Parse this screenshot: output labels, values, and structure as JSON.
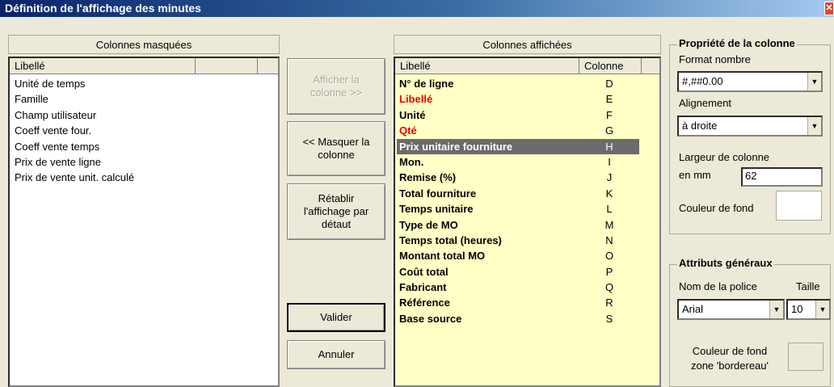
{
  "window": {
    "title": "Définition de l'affichage des minutes",
    "close_glyph": "✕"
  },
  "hidden_columns": {
    "header": "Colonnes masquées",
    "column_header": "Libellé",
    "items": [
      "Unité de temps",
      "Famille",
      "Champ utilisateur",
      "Coeff vente four.",
      "Coeff vente temps",
      "Prix de vente ligne",
      "Prix de vente unit. calculé"
    ]
  },
  "buttons": {
    "show_column": "Afficher la colonne >>",
    "hide_column": "<< Masquer la colonne",
    "restore_default": "Rétablir l'affichage par détaut",
    "validate": "Valider",
    "cancel": "Annuler"
  },
  "shown_columns": {
    "header": "Colonnes affichées",
    "col_label": "Libellé",
    "col_code": "Colonne",
    "rows": [
      {
        "label": "N° de ligne",
        "code": "D",
        "red": false,
        "selected": false
      },
      {
        "label": "Libellé",
        "code": "E",
        "red": true,
        "selected": false
      },
      {
        "label": "Unité",
        "code": "F",
        "red": false,
        "selected": false
      },
      {
        "label": "Qté",
        "code": "G",
        "red": true,
        "selected": false
      },
      {
        "label": "Prix unitaire fourniture",
        "code": "H",
        "red": false,
        "selected": true
      },
      {
        "label": "Mon.",
        "code": "I",
        "red": false,
        "selected": false
      },
      {
        "label": "Remise (%)",
        "code": "J",
        "red": false,
        "selected": false
      },
      {
        "label": "Total fourniture",
        "code": "K",
        "red": false,
        "selected": false
      },
      {
        "label": "Temps unitaire",
        "code": "L",
        "red": false,
        "selected": false
      },
      {
        "label": "Type de MO",
        "code": "M",
        "red": false,
        "selected": false
      },
      {
        "label": "Temps total (heures)",
        "code": "N",
        "red": false,
        "selected": false
      },
      {
        "label": "Montant total MO",
        "code": "O",
        "red": false,
        "selected": false
      },
      {
        "label": "Coût total",
        "code": "P",
        "red": false,
        "selected": false
      },
      {
        "label": "Fabricant",
        "code": "Q",
        "red": false,
        "selected": false
      },
      {
        "label": "Référence",
        "code": "R",
        "red": false,
        "selected": false
      },
      {
        "label": "Base source",
        "code": "S",
        "red": false,
        "selected": false
      }
    ]
  },
  "column_properties": {
    "title": "Propriété de la colonne",
    "number_format_label": "Format nombre",
    "number_format_value": "#,##0.00",
    "alignment_label": "Alignement",
    "alignment_value": "à droite",
    "width_label_line1": "Largeur de colonne",
    "width_label_line2": "en mm",
    "width_value": "62",
    "background_label": "Couleur de fond",
    "background_color": "#ffffff"
  },
  "general_attributes": {
    "title": "Attributs généraux",
    "font_label": "Nom de la police",
    "size_label": "Taille",
    "font_value": "Arial",
    "size_value": "10",
    "zone_bg_label_line1": "Couleur de fond",
    "zone_bg_label_line2": "zone 'bordereau'",
    "zone_bg_color": "#ece9d8"
  },
  "colors": {
    "selected_row": "#6b6b6b",
    "required_label": "#ee0000",
    "shown_list_bg": "#ffffc6"
  }
}
